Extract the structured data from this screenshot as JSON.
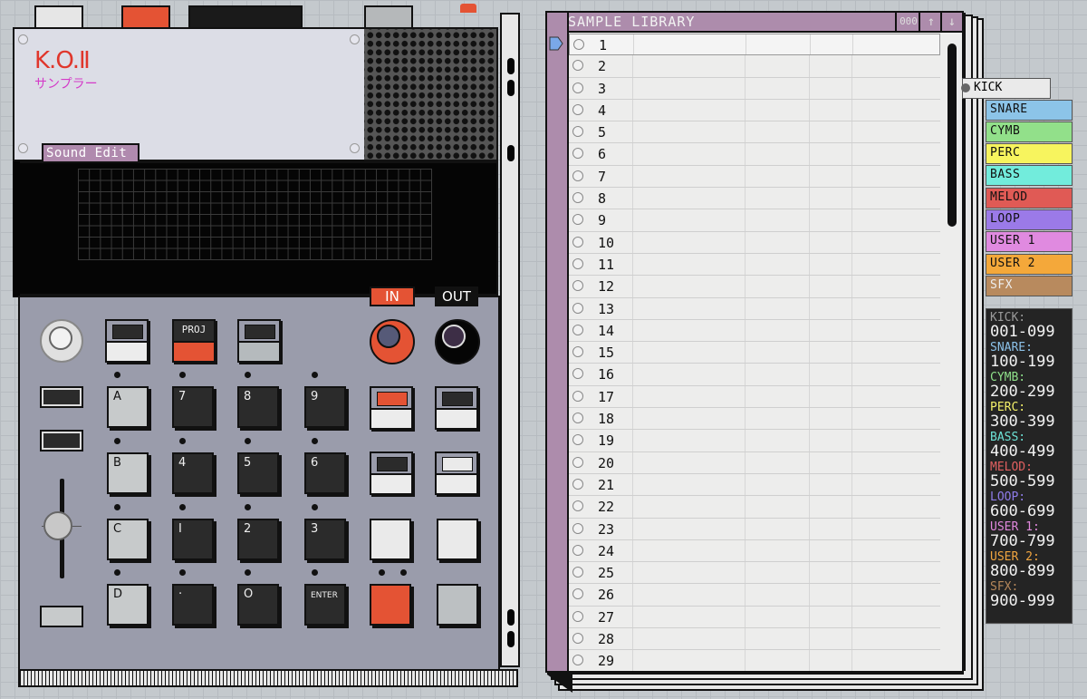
{
  "device": {
    "logo": "K.O.Ⅱ",
    "logo_sub": "サンプラー",
    "mode_label": "Sound Edit",
    "in_label": "IN",
    "out_label": "OUT",
    "proj_label": "PROJ",
    "keys": {
      "a": "A",
      "b": "B",
      "c": "C",
      "d": "D",
      "k7": "7",
      "k8": "8",
      "k9": "9",
      "k4": "4",
      "k5": "5",
      "k6": "6",
      "k1": "I",
      "k2": "2",
      "k3": "3",
      "dot": "·",
      "k0": "O",
      "enter": "ENTER"
    }
  },
  "library": {
    "title": "SAMPLE LIBRARY",
    "counter": "000",
    "up_icon": "↑",
    "down_icon": "↓",
    "selected": "1",
    "rows": [
      "1",
      "2",
      "3",
      "4",
      "5",
      "6",
      "7",
      "8",
      "9",
      "10",
      "11",
      "12",
      "13",
      "14",
      "15",
      "16",
      "17",
      "18",
      "19",
      "20",
      "21",
      "22",
      "23",
      "24",
      "25",
      "26",
      "27",
      "28",
      "29"
    ]
  },
  "categories": {
    "kick": "KICK",
    "snare": "SNARE",
    "cymb": "CYMB",
    "perc": "PERC",
    "bass": "BASS",
    "melod": "MELOD",
    "loop": "LOOP",
    "user1": "USER 1",
    "user2": "USER 2",
    "sfx": "SFX"
  },
  "ranges": [
    {
      "label": "KICK:",
      "range": "001-099",
      "color": "#9a9a9a"
    },
    {
      "label": "SNARE:",
      "range": "100-199",
      "color": "#8cc1e8"
    },
    {
      "label": "CYMB:",
      "range": "200-299",
      "color": "#8fe08a"
    },
    {
      "label": "PERC:",
      "range": "300-399",
      "color": "#f4f06a"
    },
    {
      "label": "BASS:",
      "range": "400-499",
      "color": "#6de2d6"
    },
    {
      "label": "MELOD:",
      "range": "500-599",
      "color": "#e06060"
    },
    {
      "label": "LOOP:",
      "range": "600-699",
      "color": "#8e7ce8"
    },
    {
      "label": "USER 1:",
      "range": "700-799",
      "color": "#e088dc"
    },
    {
      "label": "USER 2:",
      "range": "800-899",
      "color": "#f0a540"
    },
    {
      "label": "SFX:",
      "range": "900-999",
      "color": "#b5875a"
    }
  ],
  "colors": {
    "kick": "#eaeaea",
    "snare": "#8cc4e8",
    "cymb": "#92e08a",
    "perc": "#f7f45e",
    "bass": "#72ecdc",
    "melod": "#e05a55",
    "loop": "#9b7ae8",
    "user1": "#e08ae0",
    "user2": "#f4a83a",
    "sfx": "#b88a5e"
  }
}
